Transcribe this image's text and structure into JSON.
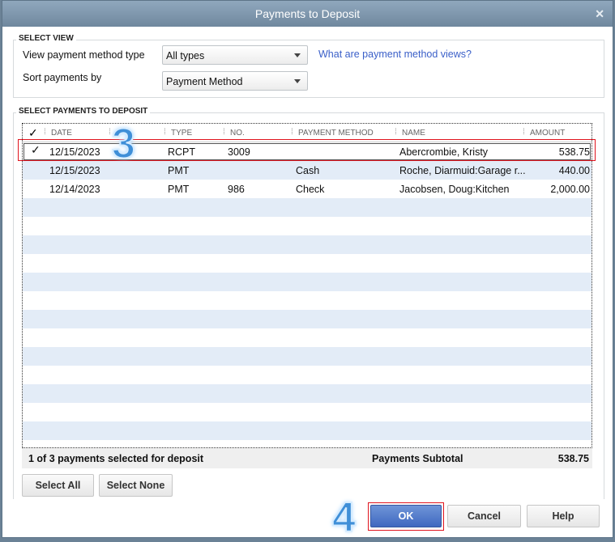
{
  "title": "Payments to Deposit",
  "select_view": {
    "legend": "SELECT VIEW",
    "method_label": "View payment method type",
    "method_value": "All types",
    "sort_label": "Sort payments by",
    "sort_value": "Payment Method",
    "help_link": "What are payment method views?"
  },
  "payments": {
    "legend": "SELECT PAYMENTS TO DEPOSIT",
    "columns": {
      "check": "✓",
      "date": "DATE",
      "blank": "",
      "type": "TYPE",
      "no": "NO.",
      "method": "PAYMENT METHOD",
      "name": "NAME",
      "amount": "AMOUNT"
    },
    "rows": [
      {
        "check": "✓",
        "date": "12/15/2023",
        "type": "RCPT",
        "no": "3009",
        "method": "",
        "name": "Abercrombie, Kristy",
        "amount": "538.75"
      },
      {
        "check": "",
        "date": "12/15/2023",
        "type": "PMT",
        "no": "",
        "method": "Cash",
        "name": "Roche, Diarmuid:Garage r...",
        "amount": "440.00"
      },
      {
        "check": "",
        "date": "12/14/2023",
        "type": "PMT",
        "no": "986",
        "method": "Check",
        "name": "Jacobsen, Doug:Kitchen",
        "amount": "2,000.00"
      }
    ],
    "status": "1 of 3 payments selected for deposit",
    "subtotal_label": "Payments Subtotal",
    "subtotal": "538.75"
  },
  "buttons": {
    "select_all": "Select All",
    "select_none": "Select None",
    "ok": "OK",
    "cancel": "Cancel",
    "help": "Help"
  },
  "annotations": {
    "step3": "3",
    "step4": "4"
  }
}
